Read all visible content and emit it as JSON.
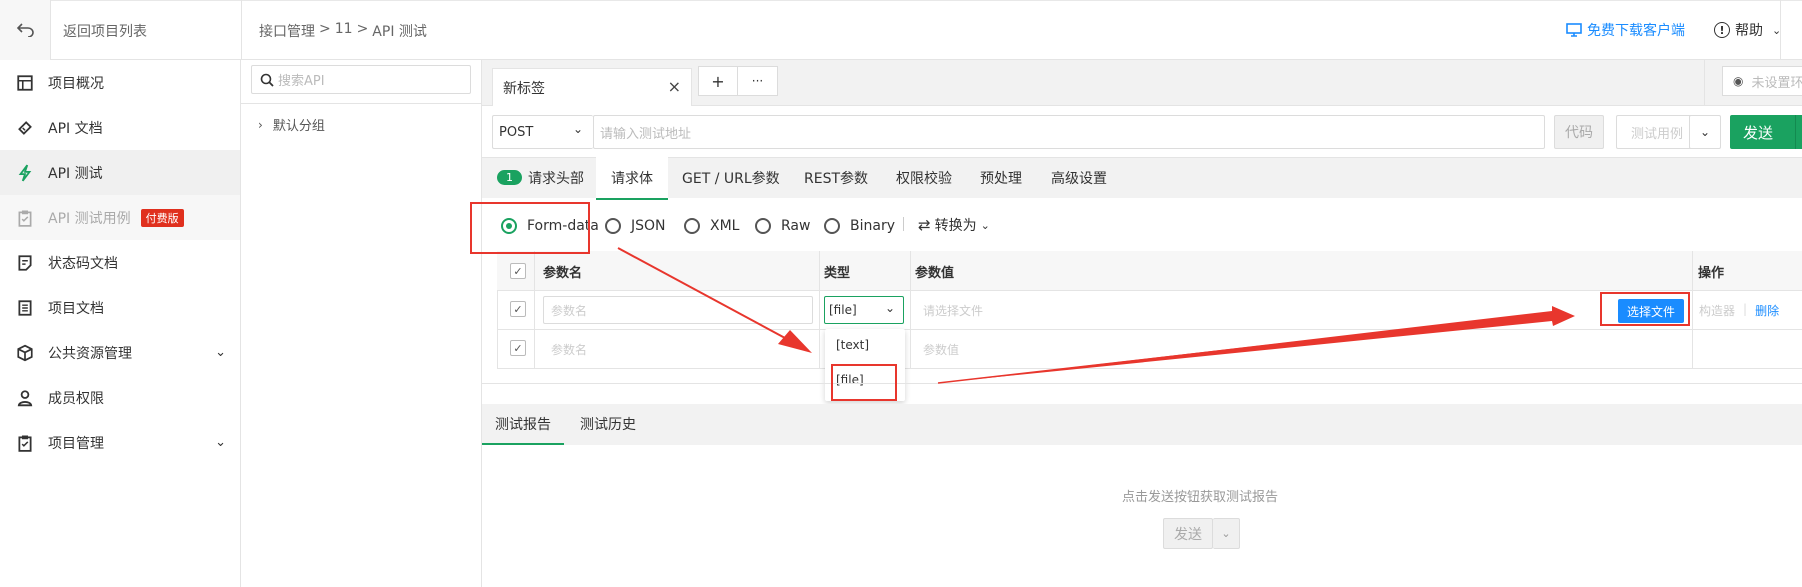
{
  "topbar": {
    "back_label": "返回项目列表",
    "breadcrumb": [
      "接口管理",
      ">",
      "11",
      ">",
      "API 测试"
    ],
    "download_label": "免费下载客户端",
    "help_label": "帮助"
  },
  "sidebar": {
    "items": [
      {
        "label": "项目概况",
        "icon": "dashboard-icon"
      },
      {
        "label": "API 文档",
        "icon": "ticket-icon"
      },
      {
        "label": "API 测试",
        "icon": "bolt-icon"
      },
      {
        "label": "API 测试用例",
        "icon": "clipboard-icon",
        "badge": "付费版"
      },
      {
        "label": "状态码文档",
        "icon": "note-icon"
      },
      {
        "label": "项目文档",
        "icon": "document-icon"
      },
      {
        "label": "公共资源管理",
        "icon": "cube-icon"
      },
      {
        "label": "成员权限",
        "icon": "user-icon"
      },
      {
        "label": "项目管理",
        "icon": "checklist-icon"
      }
    ]
  },
  "tree": {
    "search_placeholder": "搜索API",
    "group_label": "默认分组"
  },
  "tabs_bar": {
    "tab_label": "新标签",
    "add_label": "+",
    "more_label": "···",
    "env_label": "未设置环"
  },
  "request": {
    "method": "POST",
    "url_placeholder": "请输入测试地址",
    "code_label": "代码",
    "testcase_label": "测试用例",
    "send_label": "发送"
  },
  "req_tabs": [
    {
      "label": "请求头部",
      "count": "1"
    },
    {
      "label": "请求体"
    },
    {
      "label": "GET / URL参数"
    },
    {
      "label": "REST参数"
    },
    {
      "label": "权限校验"
    },
    {
      "label": "预处理"
    },
    {
      "label": "高级设置"
    }
  ],
  "body_types": [
    "Form-data",
    "JSON",
    "XML",
    "Raw",
    "Binary"
  ],
  "convert_label": "转换为",
  "table": {
    "headers": [
      "参数名",
      "类型",
      "参数值",
      "操作"
    ],
    "rows": [
      {
        "name_placeholder": "参数名",
        "type": "[file]",
        "value_placeholder": "请选择文件",
        "choose_file": "选择文件",
        "builder": "构造器",
        "sep": "|",
        "delete": "删除"
      },
      {
        "name_placeholder": "参数名",
        "value_placeholder": "参数值"
      }
    ],
    "dropdown_options": [
      "[text]",
      "[file]"
    ]
  },
  "report": {
    "tabs": [
      "测试报告",
      "测试历史"
    ],
    "hint": "点击发送按钮获取测试报告",
    "send_label": "发送"
  },
  "colors": {
    "accent_green": "#1aa260",
    "annotation_red": "#e8362d",
    "link_blue": "#1a8cff",
    "badge_red": "#e0301e"
  }
}
